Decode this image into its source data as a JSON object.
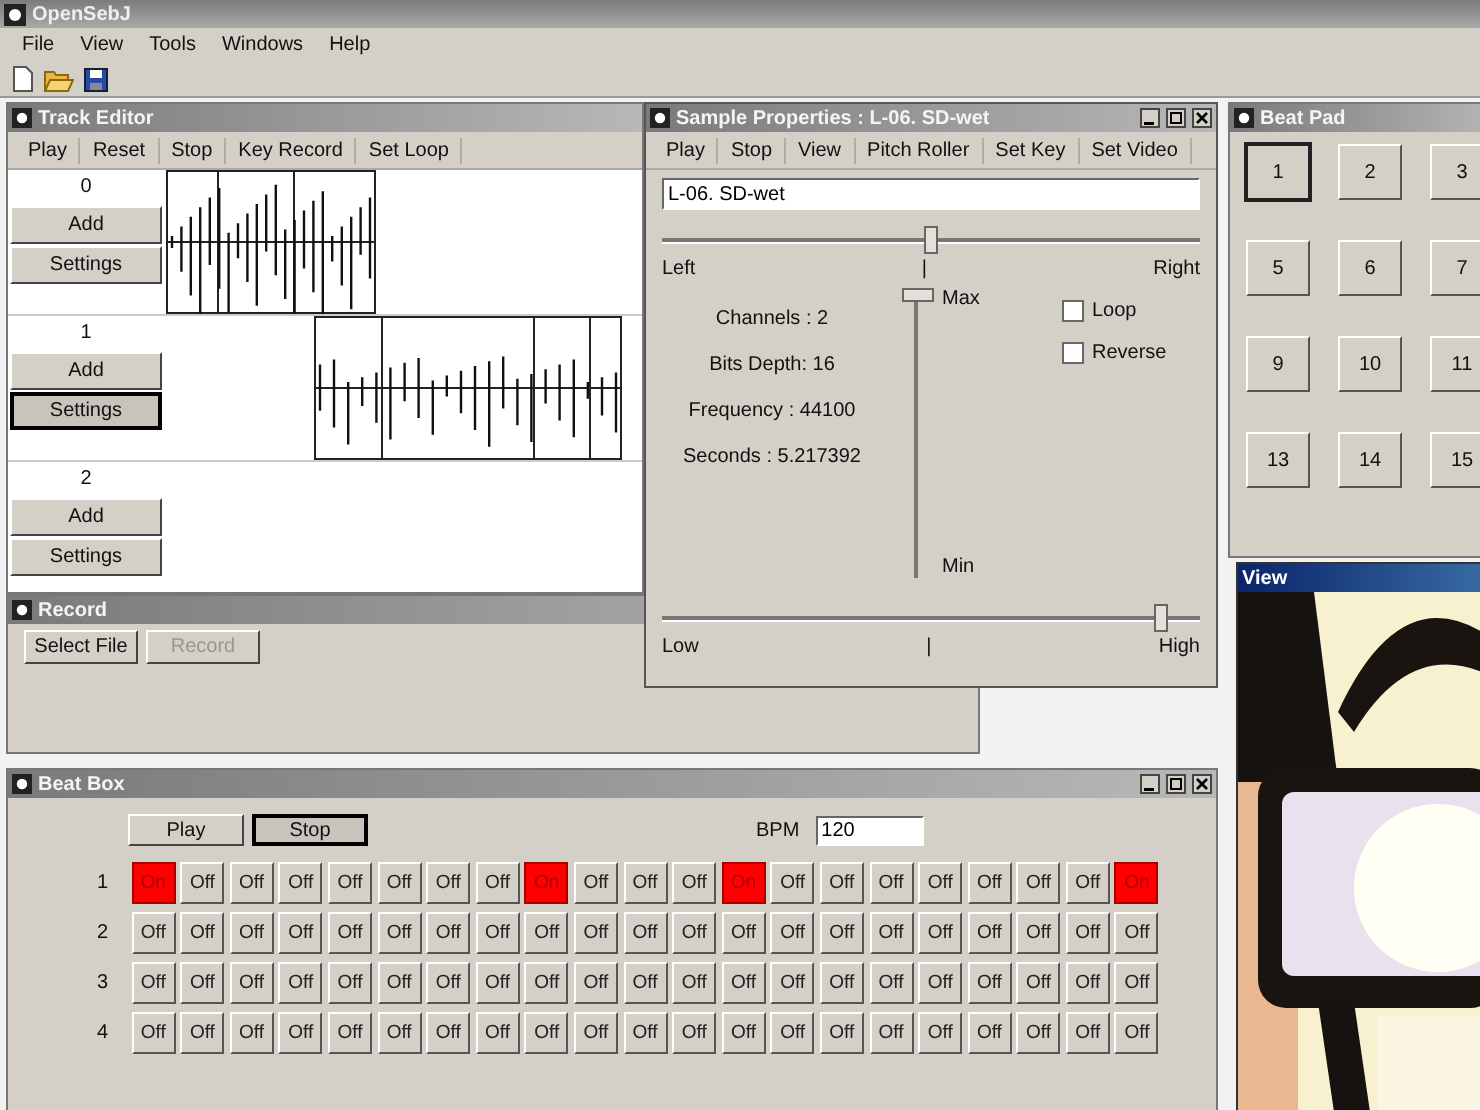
{
  "app": {
    "title": "OpenSebJ",
    "menu": [
      "File",
      "View",
      "Tools",
      "Windows",
      "Help"
    ]
  },
  "track_editor": {
    "title": "Track Editor",
    "toolbar": [
      "Play",
      "Reset",
      "Stop",
      "Key Record",
      "Set Loop"
    ],
    "tracks": [
      {
        "label": "0",
        "add": "Add",
        "settings": "Settings",
        "settings_focused": false,
        "waveform": true
      },
      {
        "label": "1",
        "add": "Add",
        "settings": "Settings",
        "settings_focused": true,
        "waveform": true
      },
      {
        "label": "2",
        "add": "Add",
        "settings": "Settings",
        "settings_focused": false,
        "waveform": false
      }
    ]
  },
  "record": {
    "title": "Record",
    "buttons": [
      {
        "label": "Select File",
        "disabled": false
      },
      {
        "label": "Record",
        "disabled": true
      }
    ]
  },
  "sample_properties": {
    "title": "Sample Properties : L-06. SD-wet",
    "toolbar": [
      "Play",
      "Stop",
      "View",
      "Pitch Roller",
      "Set Key",
      "Set Video"
    ],
    "name_field": {
      "value": "L-06. SD-wet"
    },
    "pan": {
      "level": 0.5,
      "left": "Left",
      "center": "|",
      "right": "Right"
    },
    "volume": {
      "level": 1,
      "max": "Max",
      "min": "Min"
    },
    "info": [
      "Channels : 2",
      "Bits Depth: 16",
      "Frequency : 44100",
      "Seconds : 5.217392"
    ],
    "checkboxes": [
      {
        "label": "Loop",
        "checked": false
      },
      {
        "label": "Reverse",
        "checked": false
      }
    ],
    "pitch": {
      "level": 0.93,
      "low": "Low",
      "center": "|",
      "high": "High"
    }
  },
  "beat_pad": {
    "title": "Beat Pad",
    "pads": [
      {
        "label": "1",
        "selected": true
      },
      {
        "label": "2",
        "selected": false
      },
      {
        "label": "3",
        "selected": false
      },
      {
        "label": "5",
        "selected": false
      },
      {
        "label": "6",
        "selected": false
      },
      {
        "label": "7",
        "selected": false
      },
      {
        "label": "9",
        "selected": false
      },
      {
        "label": "10",
        "selected": false
      },
      {
        "label": "11",
        "selected": false
      },
      {
        "label": "13",
        "selected": false
      },
      {
        "label": "14",
        "selected": false
      },
      {
        "label": "15",
        "selected": false
      }
    ]
  },
  "view": {
    "title": "View"
  },
  "beat_box": {
    "title": "Beat Box",
    "buttons": [
      {
        "label": "Play",
        "focused": false
      },
      {
        "label": "Stop",
        "focused": true
      }
    ],
    "bpm": {
      "label": "BPM",
      "value": "120"
    },
    "rows": [
      {
        "label": "1",
        "steps": [
          {
            "label": "On",
            "on": true
          },
          {
            "label": "Off",
            "on": false
          },
          {
            "label": "Off",
            "on": false
          },
          {
            "label": "Off",
            "on": false
          },
          {
            "label": "Off",
            "on": false
          },
          {
            "label": "Off",
            "on": false
          },
          {
            "label": "Off",
            "on": false
          },
          {
            "label": "Off",
            "on": false
          },
          {
            "label": "On",
            "on": true
          },
          {
            "label": "Off",
            "on": false
          },
          {
            "label": "Off",
            "on": false
          },
          {
            "label": "Off",
            "on": false
          },
          {
            "label": "On",
            "on": true
          },
          {
            "label": "Off",
            "on": false
          },
          {
            "label": "Off",
            "on": false
          },
          {
            "label": "Off",
            "on": false
          },
          {
            "label": "Off",
            "on": false
          },
          {
            "label": "Off",
            "on": false
          },
          {
            "label": "Off",
            "on": false
          },
          {
            "label": "Off",
            "on": false
          },
          {
            "label": "On",
            "on": true
          }
        ]
      },
      {
        "label": "2",
        "steps": [
          {
            "label": "Off",
            "on": false
          },
          {
            "label": "Off",
            "on": false
          },
          {
            "label": "Off",
            "on": false
          },
          {
            "label": "Off",
            "on": false
          },
          {
            "label": "Off",
            "on": false
          },
          {
            "label": "Off",
            "on": false
          },
          {
            "label": "Off",
            "on": false
          },
          {
            "label": "Off",
            "on": false
          },
          {
            "label": "Off",
            "on": false
          },
          {
            "label": "Off",
            "on": false
          },
          {
            "label": "Off",
            "on": false
          },
          {
            "label": "Off",
            "on": false
          },
          {
            "label": "Off",
            "on": false
          },
          {
            "label": "Off",
            "on": false
          },
          {
            "label": "Off",
            "on": false
          },
          {
            "label": "Off",
            "on": false
          },
          {
            "label": "Off",
            "on": false
          },
          {
            "label": "Off",
            "on": false
          },
          {
            "label": "Off",
            "on": false
          },
          {
            "label": "Off",
            "on": false
          },
          {
            "label": "Off",
            "on": false
          }
        ]
      },
      {
        "label": "3",
        "steps": [
          {
            "label": "Off",
            "on": false
          },
          {
            "label": "Off",
            "on": false
          },
          {
            "label": "Off",
            "on": false
          },
          {
            "label": "Off",
            "on": false
          },
          {
            "label": "Off",
            "on": false
          },
          {
            "label": "Off",
            "on": false
          },
          {
            "label": "Off",
            "on": false
          },
          {
            "label": "Off",
            "on": false
          },
          {
            "label": "Off",
            "on": false
          },
          {
            "label": "Off",
            "on": false
          },
          {
            "label": "Off",
            "on": false
          },
          {
            "label": "Off",
            "on": false
          },
          {
            "label": "Off",
            "on": false
          },
          {
            "label": "Off",
            "on": false
          },
          {
            "label": "Off",
            "on": false
          },
          {
            "label": "Off",
            "on": false
          },
          {
            "label": "Off",
            "on": false
          },
          {
            "label": "Off",
            "on": false
          },
          {
            "label": "Off",
            "on": false
          },
          {
            "label": "Off",
            "on": false
          },
          {
            "label": "Off",
            "on": false
          }
        ]
      },
      {
        "label": "4",
        "steps": [
          {
            "label": "Off",
            "on": false
          },
          {
            "label": "Off",
            "on": false
          },
          {
            "label": "Off",
            "on": false
          },
          {
            "label": "Off",
            "on": false
          },
          {
            "label": "Off",
            "on": false
          },
          {
            "label": "Off",
            "on": false
          },
          {
            "label": "Off",
            "on": false
          },
          {
            "label": "Off",
            "on": false
          },
          {
            "label": "Off",
            "on": false
          },
          {
            "label": "Off",
            "on": false
          },
          {
            "label": "Off",
            "on": false
          },
          {
            "label": "Off",
            "on": false
          },
          {
            "label": "Off",
            "on": false
          },
          {
            "label": "Off",
            "on": false
          },
          {
            "label": "Off",
            "on": false
          },
          {
            "label": "Off",
            "on": false
          },
          {
            "label": "Off",
            "on": false
          },
          {
            "label": "Off",
            "on": false
          },
          {
            "label": "Off",
            "on": false
          },
          {
            "label": "Off",
            "on": false
          },
          {
            "label": "Off",
            "on": false
          }
        ]
      }
    ]
  }
}
